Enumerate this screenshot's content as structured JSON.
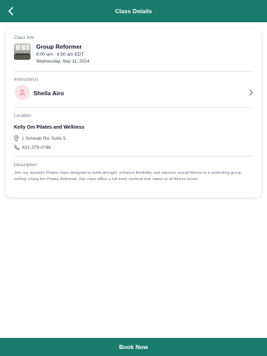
{
  "header": {
    "title": "Class Details",
    "back_icon": "chevron-left-icon"
  },
  "class_info": {
    "label": "Class Info",
    "name": "Group Reformer",
    "time": "6:00 am - 6:50 am EDT",
    "date": "Wednesday, Sep 11, 2024"
  },
  "instructor": {
    "label": "Instructor(s)",
    "name": "Sheila Airo"
  },
  "location": {
    "label": "Location",
    "name": "Kelly Om Pilates and Wellness",
    "address": "1 Schwab Rd, Suite 5",
    "phone": "631-379-0786"
  },
  "description": {
    "label": "Description",
    "text": "Join our dynamic Pilates class designed to build strength, enhance flexibility, and improve overall fitness in a motivating group setting! Using the Pilates Reformer, this class offers a full-body workout that caters to all fitness levels."
  },
  "footer": {
    "book_label": "Book Now"
  },
  "colors": {
    "brand": "#197a6e",
    "avatar_bg": "#fbe3e7",
    "avatar_icon": "#e0607a"
  }
}
